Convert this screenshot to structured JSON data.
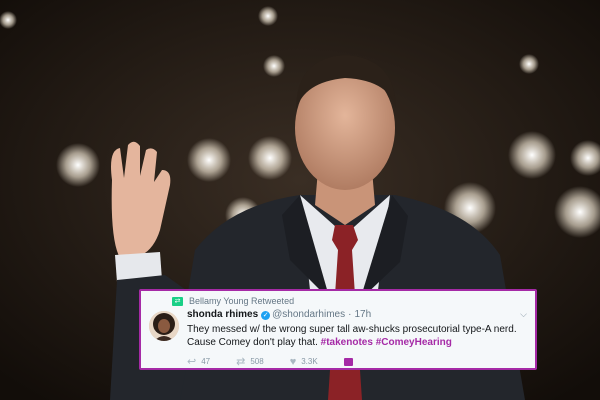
{
  "tweet": {
    "retweeted_by": "Bellamy Young Retweeted",
    "display_name": "shonda rhimes",
    "handle": "@shondarhimes",
    "separator": "·",
    "time": "17h",
    "text_part1": "They messed w/ the wrong super tall aw-shucks prosecutorial type-A nerd. Cause Comey don't play that. ",
    "hashtag1": "#takenotes",
    "hashtag2": "#ComeyHearing",
    "replies": "47",
    "retweets": "508",
    "likes": "3.3K",
    "accent_color": "#a52aa6",
    "icons": [
      "retweet-icon",
      "verified-badge-icon",
      "chevron-down-icon",
      "reply-icon",
      "like-icon",
      "direct-message-icon"
    ]
  }
}
